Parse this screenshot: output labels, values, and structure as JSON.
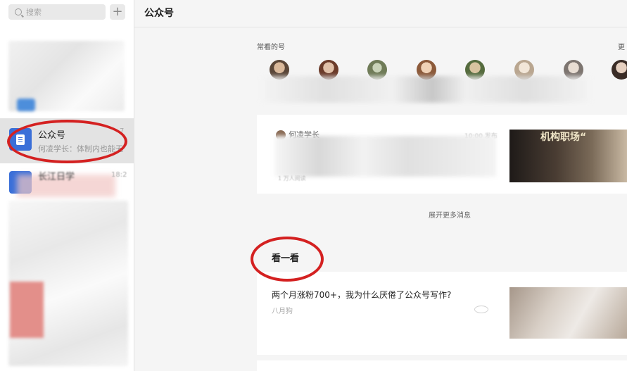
{
  "sidebar": {
    "search_placeholder": "搜索",
    "add_button": "+",
    "selected_item": {
      "title": "公众号",
      "preview": "何凌学长：体制内也能无",
      "time": "7"
    },
    "next_item": {
      "title": "长江日学",
      "time": "18:2"
    }
  },
  "header": {
    "title": "公众号"
  },
  "favorites": {
    "label": "常看的号",
    "more": "更"
  },
  "feed": {
    "author": "何凌学长",
    "time": "10:00 发布",
    "thumb_text": "机构职场“",
    "footer": "1 万人阅读"
  },
  "expand_more": "展开更多消息",
  "see": {
    "title": "看一看",
    "article": {
      "title": "两个月涨粉700+，我为什么厌倦了公众号写作?",
      "date": "八月狗"
    }
  },
  "colors": {
    "annotation": "#d42121",
    "accent": "#3a6fd8"
  }
}
